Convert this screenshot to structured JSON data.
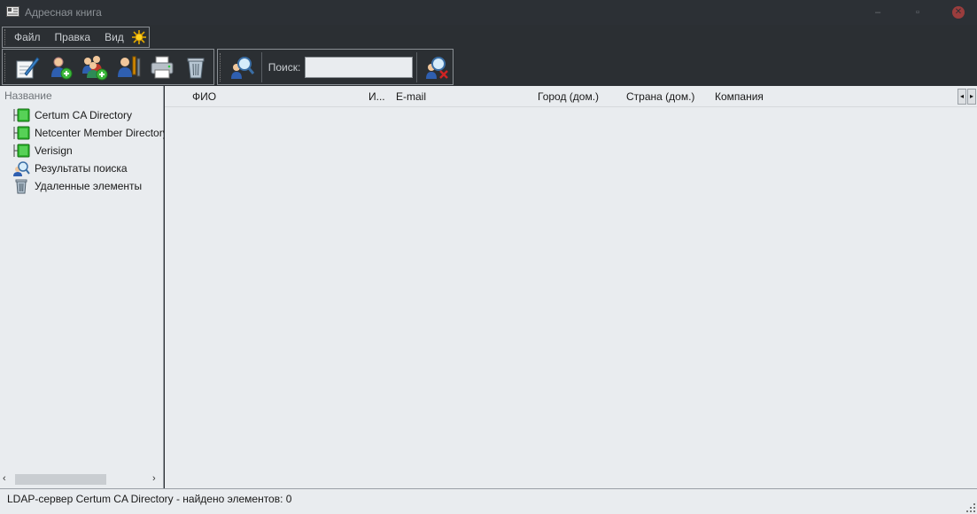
{
  "window": {
    "title": "Адресная книга",
    "minimize_symbol": "–",
    "maximize_symbol": "▫",
    "close_symbol": "✕"
  },
  "menubar": {
    "items": [
      "Файл",
      "Правка",
      "Вид"
    ]
  },
  "toolbar": {
    "buttons": [
      {
        "name": "new-message",
        "icon": "pen-paper-icon"
      },
      {
        "name": "new-contact",
        "icon": "add-contact-icon"
      },
      {
        "name": "new-group",
        "icon": "add-group-icon"
      },
      {
        "name": "properties",
        "icon": "edit-contact-icon"
      },
      {
        "name": "print",
        "icon": "printer-icon"
      },
      {
        "name": "delete",
        "icon": "trash-icon"
      }
    ],
    "find_people_icon": "find-people-icon",
    "search_label": "Поиск:",
    "search_value": "",
    "search_placeholder": "",
    "clear_search_icon": "clear-search-icon"
  },
  "left_panel": {
    "header": "Название",
    "items": [
      {
        "label": "Certum CA Directory",
        "icon": "ldap-directory-icon"
      },
      {
        "label": "Netcenter Member Directory",
        "icon": "ldap-directory-icon"
      },
      {
        "label": "Verisign",
        "icon": "ldap-directory-icon"
      },
      {
        "label": "Результаты поиска",
        "icon": "search-results-icon"
      },
      {
        "label": "Удаленные элементы",
        "icon": "deleted-items-icon"
      }
    ],
    "scroll_left": "‹",
    "scroll_right": "›"
  },
  "right_panel": {
    "columns": [
      "ФИО",
      "И...",
      "E-mail",
      "Город (дом.)",
      "Страна (дом.)",
      "Компания"
    ],
    "scroll_left": "◂",
    "scroll_right": "▸",
    "rows": []
  },
  "statusbar": {
    "text": "LDAP-сервер Certum CA Directory - найдено элементов: 0"
  },
  "colors": {
    "chrome_bg": "#2b2f33",
    "panel_bg": "#e9ecef",
    "directory_green": "#2fb52f"
  }
}
